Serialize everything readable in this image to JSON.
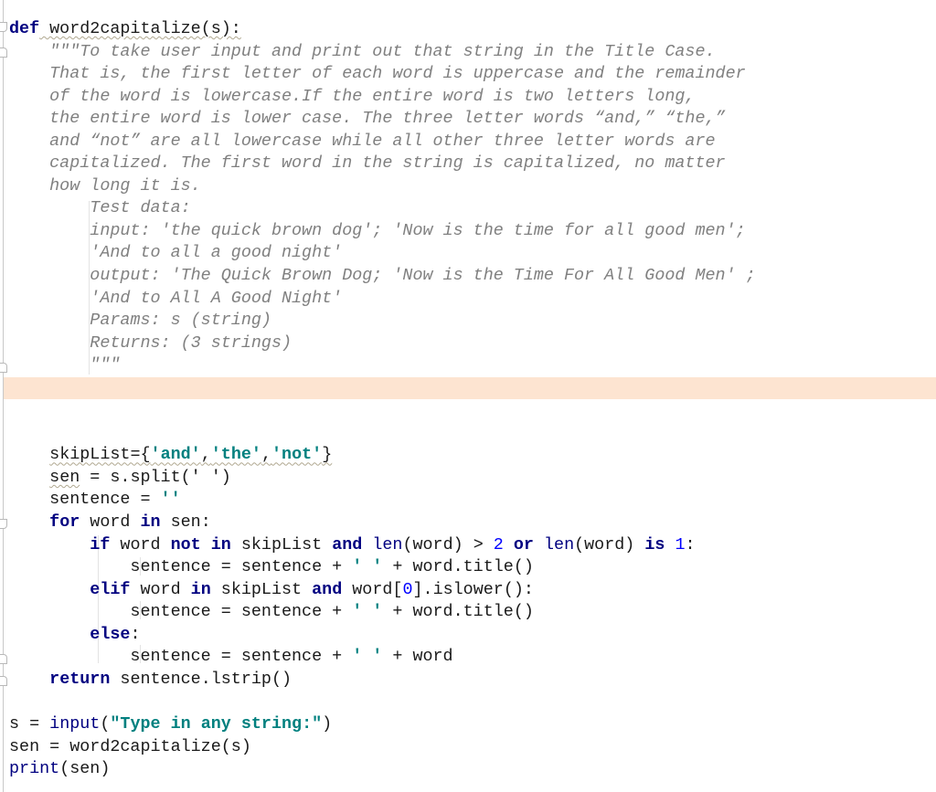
{
  "editor": {
    "language": "python",
    "highlighted_line_index": 16,
    "lines": [
      [
        {
          "t": "def",
          "c": "kw"
        },
        {
          "t": " word2capitalize(s):",
          "c": "plain",
          "squig": true
        }
      ],
      [
        {
          "t": "    \"\"\"To take user input and print out that string in the Title Case.",
          "c": "doc"
        }
      ],
      [
        {
          "t": "    That is, the first letter of each word is uppercase and the remainder",
          "c": "doc"
        }
      ],
      [
        {
          "t": "    of the word is lowercase.If the entire word is two letters long,",
          "c": "doc"
        }
      ],
      [
        {
          "t": "    the entire word is lower case. The three letter words “and,” “the,”",
          "c": "doc"
        }
      ],
      [
        {
          "t": "    and “not” are all lowercase while all other three letter words are",
          "c": "doc"
        }
      ],
      [
        {
          "t": "    capitalized. The first word in the string is capitalized, no matter",
          "c": "doc"
        }
      ],
      [
        {
          "t": "    how long it is.",
          "c": "doc"
        }
      ],
      [
        {
          "t": "        Test data:",
          "c": "doc"
        }
      ],
      [
        {
          "t": "        input: 'the quick brown dog'; 'Now is the time for all good men';",
          "c": "doc"
        }
      ],
      [
        {
          "t": "        'And to all a good night'",
          "c": "doc"
        }
      ],
      [
        {
          "t": "        output: 'The Quick Brown Dog; 'Now is the Time For All Good Men' ;",
          "c": "doc"
        }
      ],
      [
        {
          "t": "        'And to All A Good Night'",
          "c": "doc"
        }
      ],
      [
        {
          "t": "        Params: s (string)",
          "c": "doc"
        }
      ],
      [
        {
          "t": "        Returns: (3 strings)",
          "c": "doc"
        }
      ],
      [
        {
          "t": "        \"\"\"",
          "c": "doc"
        }
      ],
      [],
      [],
      [],
      [
        {
          "t": "    ",
          "c": "plain"
        },
        {
          "t": "skipList={",
          "c": "plain",
          "squig": true
        },
        {
          "t": "'and'",
          "c": "str",
          "squig": true
        },
        {
          "t": ",",
          "c": "plain",
          "squig": true
        },
        {
          "t": "'the'",
          "c": "str",
          "squig": true
        },
        {
          "t": ",",
          "c": "plain",
          "squig": true
        },
        {
          "t": "'not'",
          "c": "str",
          "squig": true
        },
        {
          "t": "}",
          "c": "plain",
          "squig": true
        }
      ],
      [
        {
          "t": "    ",
          "c": "plain"
        },
        {
          "t": "sen",
          "c": "plain",
          "squig": true
        },
        {
          "t": " = s.split(' ')",
          "c": "plain"
        }
      ],
      [
        {
          "t": "    sentence = ",
          "c": "plain"
        },
        {
          "t": "''",
          "c": "str"
        }
      ],
      [
        {
          "t": "    ",
          "c": "plain"
        },
        {
          "t": "for",
          "c": "kw"
        },
        {
          "t": " word ",
          "c": "plain"
        },
        {
          "t": "in",
          "c": "kw"
        },
        {
          "t": " sen:",
          "c": "plain"
        }
      ],
      [
        {
          "t": "        ",
          "c": "plain"
        },
        {
          "t": "if",
          "c": "kw"
        },
        {
          "t": " word ",
          "c": "plain"
        },
        {
          "t": "not in",
          "c": "kw"
        },
        {
          "t": " skipList ",
          "c": "plain"
        },
        {
          "t": "and",
          "c": "kw"
        },
        {
          "t": " ",
          "c": "plain"
        },
        {
          "t": "len",
          "c": "builtin"
        },
        {
          "t": "(word) > ",
          "c": "plain"
        },
        {
          "t": "2",
          "c": "num"
        },
        {
          "t": " ",
          "c": "plain"
        },
        {
          "t": "or",
          "c": "kw"
        },
        {
          "t": " ",
          "c": "plain"
        },
        {
          "t": "len",
          "c": "builtin"
        },
        {
          "t": "(word) ",
          "c": "plain"
        },
        {
          "t": "is",
          "c": "kw"
        },
        {
          "t": " ",
          "c": "plain"
        },
        {
          "t": "1",
          "c": "num"
        },
        {
          "t": ":",
          "c": "plain"
        }
      ],
      [
        {
          "t": "            sentence = sentence + ",
          "c": "plain"
        },
        {
          "t": "' '",
          "c": "str"
        },
        {
          "t": " + word.title()",
          "c": "plain"
        }
      ],
      [
        {
          "t": "        ",
          "c": "plain"
        },
        {
          "t": "elif",
          "c": "kw"
        },
        {
          "t": " word ",
          "c": "plain"
        },
        {
          "t": "in",
          "c": "kw"
        },
        {
          "t": " skipList ",
          "c": "plain"
        },
        {
          "t": "and",
          "c": "kw"
        },
        {
          "t": " word[",
          "c": "plain"
        },
        {
          "t": "0",
          "c": "num"
        },
        {
          "t": "].islower():",
          "c": "plain"
        }
      ],
      [
        {
          "t": "            sentence = sentence + ",
          "c": "plain"
        },
        {
          "t": "' '",
          "c": "str"
        },
        {
          "t": " + word.title()",
          "c": "plain"
        }
      ],
      [
        {
          "t": "        ",
          "c": "plain"
        },
        {
          "t": "else",
          "c": "kw"
        },
        {
          "t": ":",
          "c": "plain"
        }
      ],
      [
        {
          "t": "            sentence = sentence + ",
          "c": "plain"
        },
        {
          "t": "' '",
          "c": "str"
        },
        {
          "t": " + word",
          "c": "plain"
        }
      ],
      [
        {
          "t": "    ",
          "c": "plain"
        },
        {
          "t": "return",
          "c": "kw"
        },
        {
          "t": " sentence.lstrip()",
          "c": "plain"
        }
      ],
      [],
      [
        {
          "t": "s = ",
          "c": "plain"
        },
        {
          "t": "input",
          "c": "builtin"
        },
        {
          "t": "(",
          "c": "plain"
        },
        {
          "t": "\"Type in any string:\"",
          "c": "str"
        },
        {
          "t": ")",
          "c": "plain"
        }
      ],
      [
        {
          "t": "sen = word2capitalize(s)",
          "c": "plain"
        }
      ],
      [
        {
          "t": "print",
          "c": "builtin"
        },
        {
          "t": "(sen)",
          "c": "plain"
        }
      ]
    ]
  },
  "colors": {
    "keyword": "#000080",
    "string": "#00807f",
    "number": "#0000ff",
    "docstring": "#808080",
    "highlight_line": "#fde4d1"
  }
}
